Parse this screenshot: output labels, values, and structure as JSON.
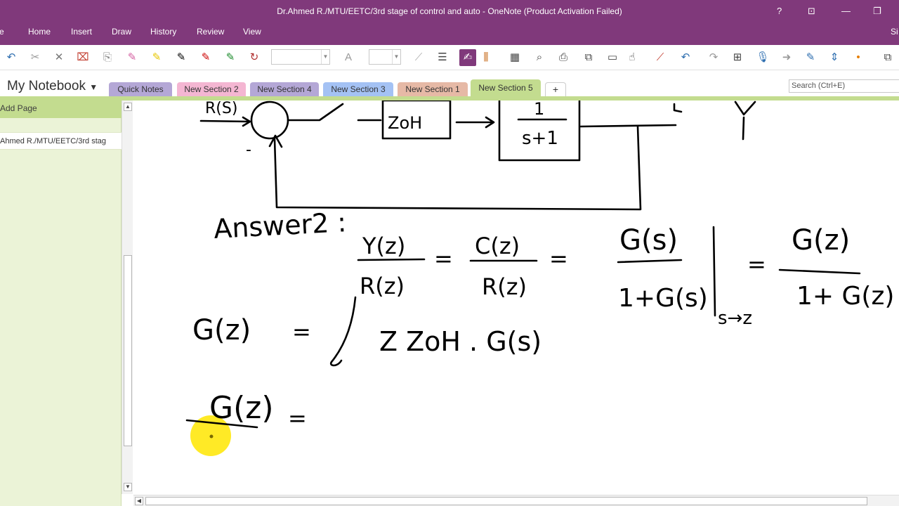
{
  "window": {
    "title": "Dr.Ahmed R./MTU/EETC/3rd stage of control and auto - OneNote (Product Activation Failed)",
    "help": "?",
    "signin_partial": "Si",
    "file_partial": "e"
  },
  "menu": {
    "items": [
      "Home",
      "Insert",
      "Draw",
      "History",
      "Review",
      "View"
    ]
  },
  "toolbar": {
    "font_glyph": "A"
  },
  "notebook": {
    "name": "My Notebook"
  },
  "sections": [
    {
      "label": "Quick Notes",
      "color": "#b4a7d6"
    },
    {
      "label": "New Section 2",
      "color": "#f4b6d2"
    },
    {
      "label": "New Section 4",
      "color": "#b4a7d6"
    },
    {
      "label": "New Section 3",
      "color": "#a4c2f4"
    },
    {
      "label": "New Section 1",
      "color": "#e6b9a6"
    },
    {
      "label": "New Section 5",
      "color": "#c3dc8f",
      "active": true
    }
  ],
  "add_section": "+",
  "search": {
    "placeholder": "Search (Ctrl+E)"
  },
  "sidebar": {
    "add_page": "Add Page",
    "pages": [
      "Ahmed R./MTU/EETC/3rd stag"
    ]
  },
  "ink": {
    "r_s": "R(S)",
    "minus": "-",
    "zoh": "ZoH",
    "tf_num": "1",
    "tf_den": "s+1",
    "answer": "Answer2 :",
    "y_z": "Y(z)",
    "r_z": "R(z)",
    "c_z": "C(z)",
    "g_s": "G(s)",
    "one_plus_g_s": "1+G(s)",
    "s_to_z": "s→z",
    "g_z": "G(z)",
    "one_plus_g_z": "1+ G(z)",
    "gz_line": "G(z)",
    "z_transform": "Z ZoH . G(s)",
    "gz_line3": "G(z)",
    "equals": "="
  },
  "colors": {
    "brand": "#80397b",
    "active_section": "#c3dc8f",
    "sidebar_bg": "#ebf3d7",
    "cursor_highlight": "#ffe600"
  }
}
